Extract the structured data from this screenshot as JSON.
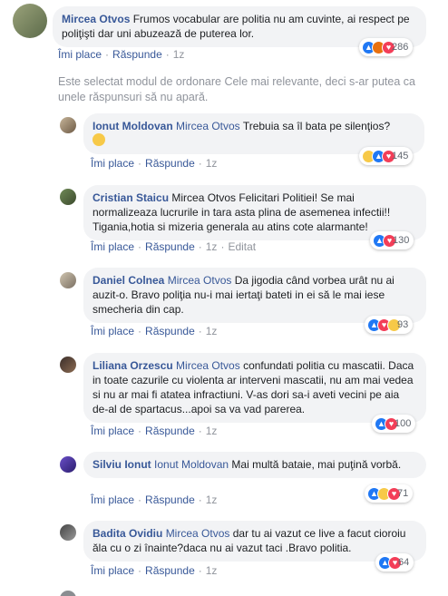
{
  "notice": "Este selectat modul de ordonare Cele mai relevante, deci s-ar putea ca unele răspunsuri să nu apară.",
  "actions": {
    "like": "Îmi place",
    "reply": "Răspunde",
    "sep": "·"
  },
  "colors": {
    "link": "#385898",
    "bubble": "#f2f3f5",
    "like": "#2078f4",
    "love": "#f33e58",
    "haha": "#f7c948",
    "angry": "#e9710f"
  },
  "comments": [
    {
      "author": "Mircea Otvos",
      "mention": "",
      "text": "Frumos vocabular are politia nu am cuvinte, ai respect pe poliţişti dar uni abuzează de puterea lor.",
      "time": "1z",
      "edited": "",
      "reactions": [
        "like-icon",
        "angry-icon",
        "love-icon"
      ],
      "count": "286"
    },
    {
      "author": "Ionut Moldovan",
      "mention": "Mircea Otvos",
      "text": "Trebuia sa îl bata pe silenţios?",
      "emoji": "grinning-face-emoji",
      "time": "1z",
      "edited": "",
      "reactions": [
        "haha-icon",
        "like-icon",
        "love-icon"
      ],
      "count": "145"
    },
    {
      "author": "Cristian Staicu",
      "mention": "Mircea Otvos",
      "text": "Felicitari Politiei! Se mai normalizeaza lucrurile in tara asta plina de asemenea infectii!! Tigania,hotia si mizeria generala au atins cote alarmante!",
      "time": "1z",
      "edited": "Editat",
      "reactions": [
        "like-icon",
        "love-icon"
      ],
      "count": "130"
    },
    {
      "author": "Daniel Colnea",
      "mention": "Mircea Otvos",
      "text": "Da jigodia când vorbea urât nu ai auzit-o. Bravo poliţia nu-i mai iertaţi bateti in ei să le mai iese smecheria din cap.",
      "time": "1z",
      "edited": "",
      "reactions": [
        "like-icon",
        "love-icon",
        "haha-icon"
      ],
      "count": "93"
    },
    {
      "author": "Liliana Orzescu",
      "mention": "Mircea Otvos",
      "text": "confundati politia cu mascatii. Daca in toate cazurile cu violenta ar interveni mascatii, nu am mai vedea si nu ar mai fi atatea infractiuni. V-as dori sa-i aveti vecini pe aia de-al de spartacus...apoi sa va vad parerea.",
      "time": "1z",
      "edited": "",
      "reactions": [
        "like-icon",
        "love-icon"
      ],
      "count": "100"
    },
    {
      "author": "Silviu Ionut",
      "mention": "Ionut Moldovan",
      "text": "Mai multă bataie, mai puţină vorbă.",
      "time": "1z",
      "edited": "",
      "reactions": [
        "like-icon",
        "haha-icon",
        "love-icon"
      ],
      "count": "71"
    },
    {
      "author": "Badita Ovidiu",
      "mention": "Mircea Otvos",
      "text": "dar tu ai vazut ce live a facut cioroiu ăla cu o zi înainte?daca nu ai vazut taci .Bravo politia.",
      "time": "1z",
      "edited": "",
      "reactions": [
        "like-icon",
        "love-icon"
      ],
      "count": "64"
    }
  ]
}
